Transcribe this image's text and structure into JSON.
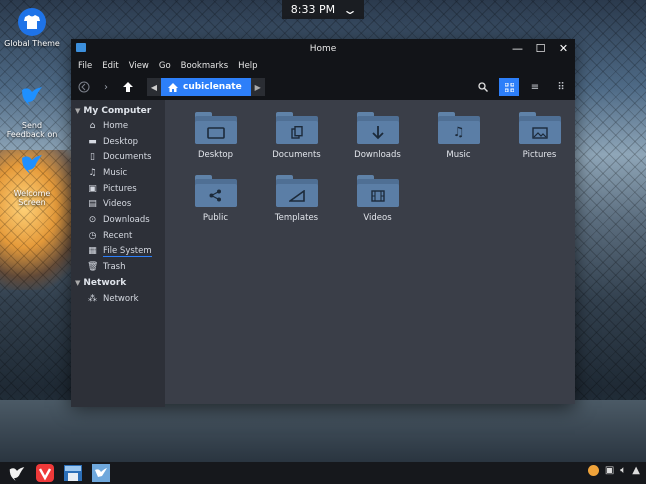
{
  "clock": {
    "time": "8:33 PM"
  },
  "desktop_icons": [
    {
      "label": "Global Theme",
      "icon": "tshirt-icon"
    },
    {
      "label": "Send\nFeedback on",
      "icon": "bird-icon"
    },
    {
      "label": "Welcome\nScreen",
      "icon": "bird-icon"
    }
  ],
  "window": {
    "title": "Home",
    "menu": [
      "File",
      "Edit",
      "View",
      "Go",
      "Bookmarks",
      "Help"
    ],
    "breadcrumb": "cubiclenate",
    "sidebar": {
      "section_my_computer": "My Computer",
      "items": [
        {
          "label": "Home",
          "icon": "home-icon"
        },
        {
          "label": "Desktop",
          "icon": "desktop-icon"
        },
        {
          "label": "Documents",
          "icon": "document-icon"
        },
        {
          "label": "Music",
          "icon": "music-icon"
        },
        {
          "label": "Pictures",
          "icon": "pictures-icon"
        },
        {
          "label": "Videos",
          "icon": "video-icon"
        },
        {
          "label": "Downloads",
          "icon": "download-icon"
        },
        {
          "label": "Recent",
          "icon": "clock-icon"
        },
        {
          "label": "File System",
          "icon": "drive-icon"
        },
        {
          "label": "Trash",
          "icon": "trash-icon"
        }
      ],
      "section_network": "Network",
      "network_items": [
        {
          "label": "Network",
          "icon": "network-icon"
        }
      ]
    },
    "files": [
      {
        "name": "Desktop",
        "icon": "desktop-icon"
      },
      {
        "name": "Documents",
        "icon": "document-icon"
      },
      {
        "name": "Downloads",
        "icon": "download-icon"
      },
      {
        "name": "Music",
        "icon": "music-icon"
      },
      {
        "name": "Pictures",
        "icon": "pictures-icon"
      },
      {
        "name": "Public",
        "icon": "share-icon"
      },
      {
        "name": "Templates",
        "icon": "template-icon"
      },
      {
        "name": "Videos",
        "icon": "video-icon"
      }
    ]
  },
  "colors": {
    "accent": "#2d7ff9",
    "folder": "#5b7ea6",
    "window_bg": "#3a3e48",
    "sidebar_bg": "#2d3038",
    "titlebar_bg": "#121418"
  }
}
